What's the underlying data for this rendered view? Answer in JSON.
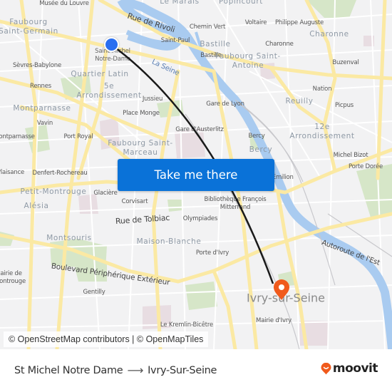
{
  "map": {
    "origin": {
      "name": "Saint-Michel Notre-Dame",
      "color": "#2a6ff0"
    },
    "destination": {
      "name": "Ivry-Sur-Seine",
      "color": "#f05a1c"
    },
    "route_color": "#1a1a1a",
    "labels": {
      "districts": [
        "Faubourg Saint-Germain",
        "Quartier Latin",
        "5e Arrondissement",
        "Montparnasse",
        "Faubourg Saint-Marceau",
        "Petit-Montrouge",
        "Alésia",
        "Montsouris",
        "Maison-Blanche",
        "Bastille",
        "Faubourg Saint-Antoine",
        "Charonne",
        "Reuilly",
        "12e Arrondissement",
        "Bercy",
        "Le Marais",
        "Popincourt"
      ],
      "places": [
        "Musée du Louvre",
        "Saint-Michel Notre-Dame",
        "Sèvres-Babylone",
        "Rennes",
        "Vavin",
        "Montparnasse",
        "Port Royal",
        "Denfert-Rochereau",
        "Glacière",
        "Corvisart",
        "Place Monge",
        "Jussieu",
        "Gare d'Austerlitz",
        "Gare de Lyon",
        "Saint-Paul",
        "Chemin Vert",
        "Bastille",
        "Voltaire",
        "Philippe Auguste",
        "Charonne",
        "Buzenval",
        "Nation",
        "Picpus",
        "Bercy",
        "Michel Bizot",
        "Porte Dorée",
        "Saint-Émilion",
        "Bibliothèque François Mitterrand",
        "Olympiades",
        "Porte d'Ivry",
        "Mairie d'Ivry",
        "Gentilly",
        "Le Kremlin-Bicêtre",
        "Mairie de Montrouge",
        "Plaisance"
      ],
      "streets": [
        "Rue de Rivoli",
        "Rue de Tolbiac",
        "Boulevard Périphérique Extérieur",
        "Autoroute de l'Est"
      ],
      "river": "La Seine",
      "city": "Ivry-sur-Seine"
    }
  },
  "button": {
    "label": "Take me there"
  },
  "attribution": "© OpenStreetMap contributors | © OpenMapTiles",
  "footer": {
    "from": "St Michel Notre Dame",
    "arrow": "⟶",
    "to": "Ivry-Sur-Seine",
    "brand": "moovit",
    "brand_color": "#f05a1c"
  }
}
